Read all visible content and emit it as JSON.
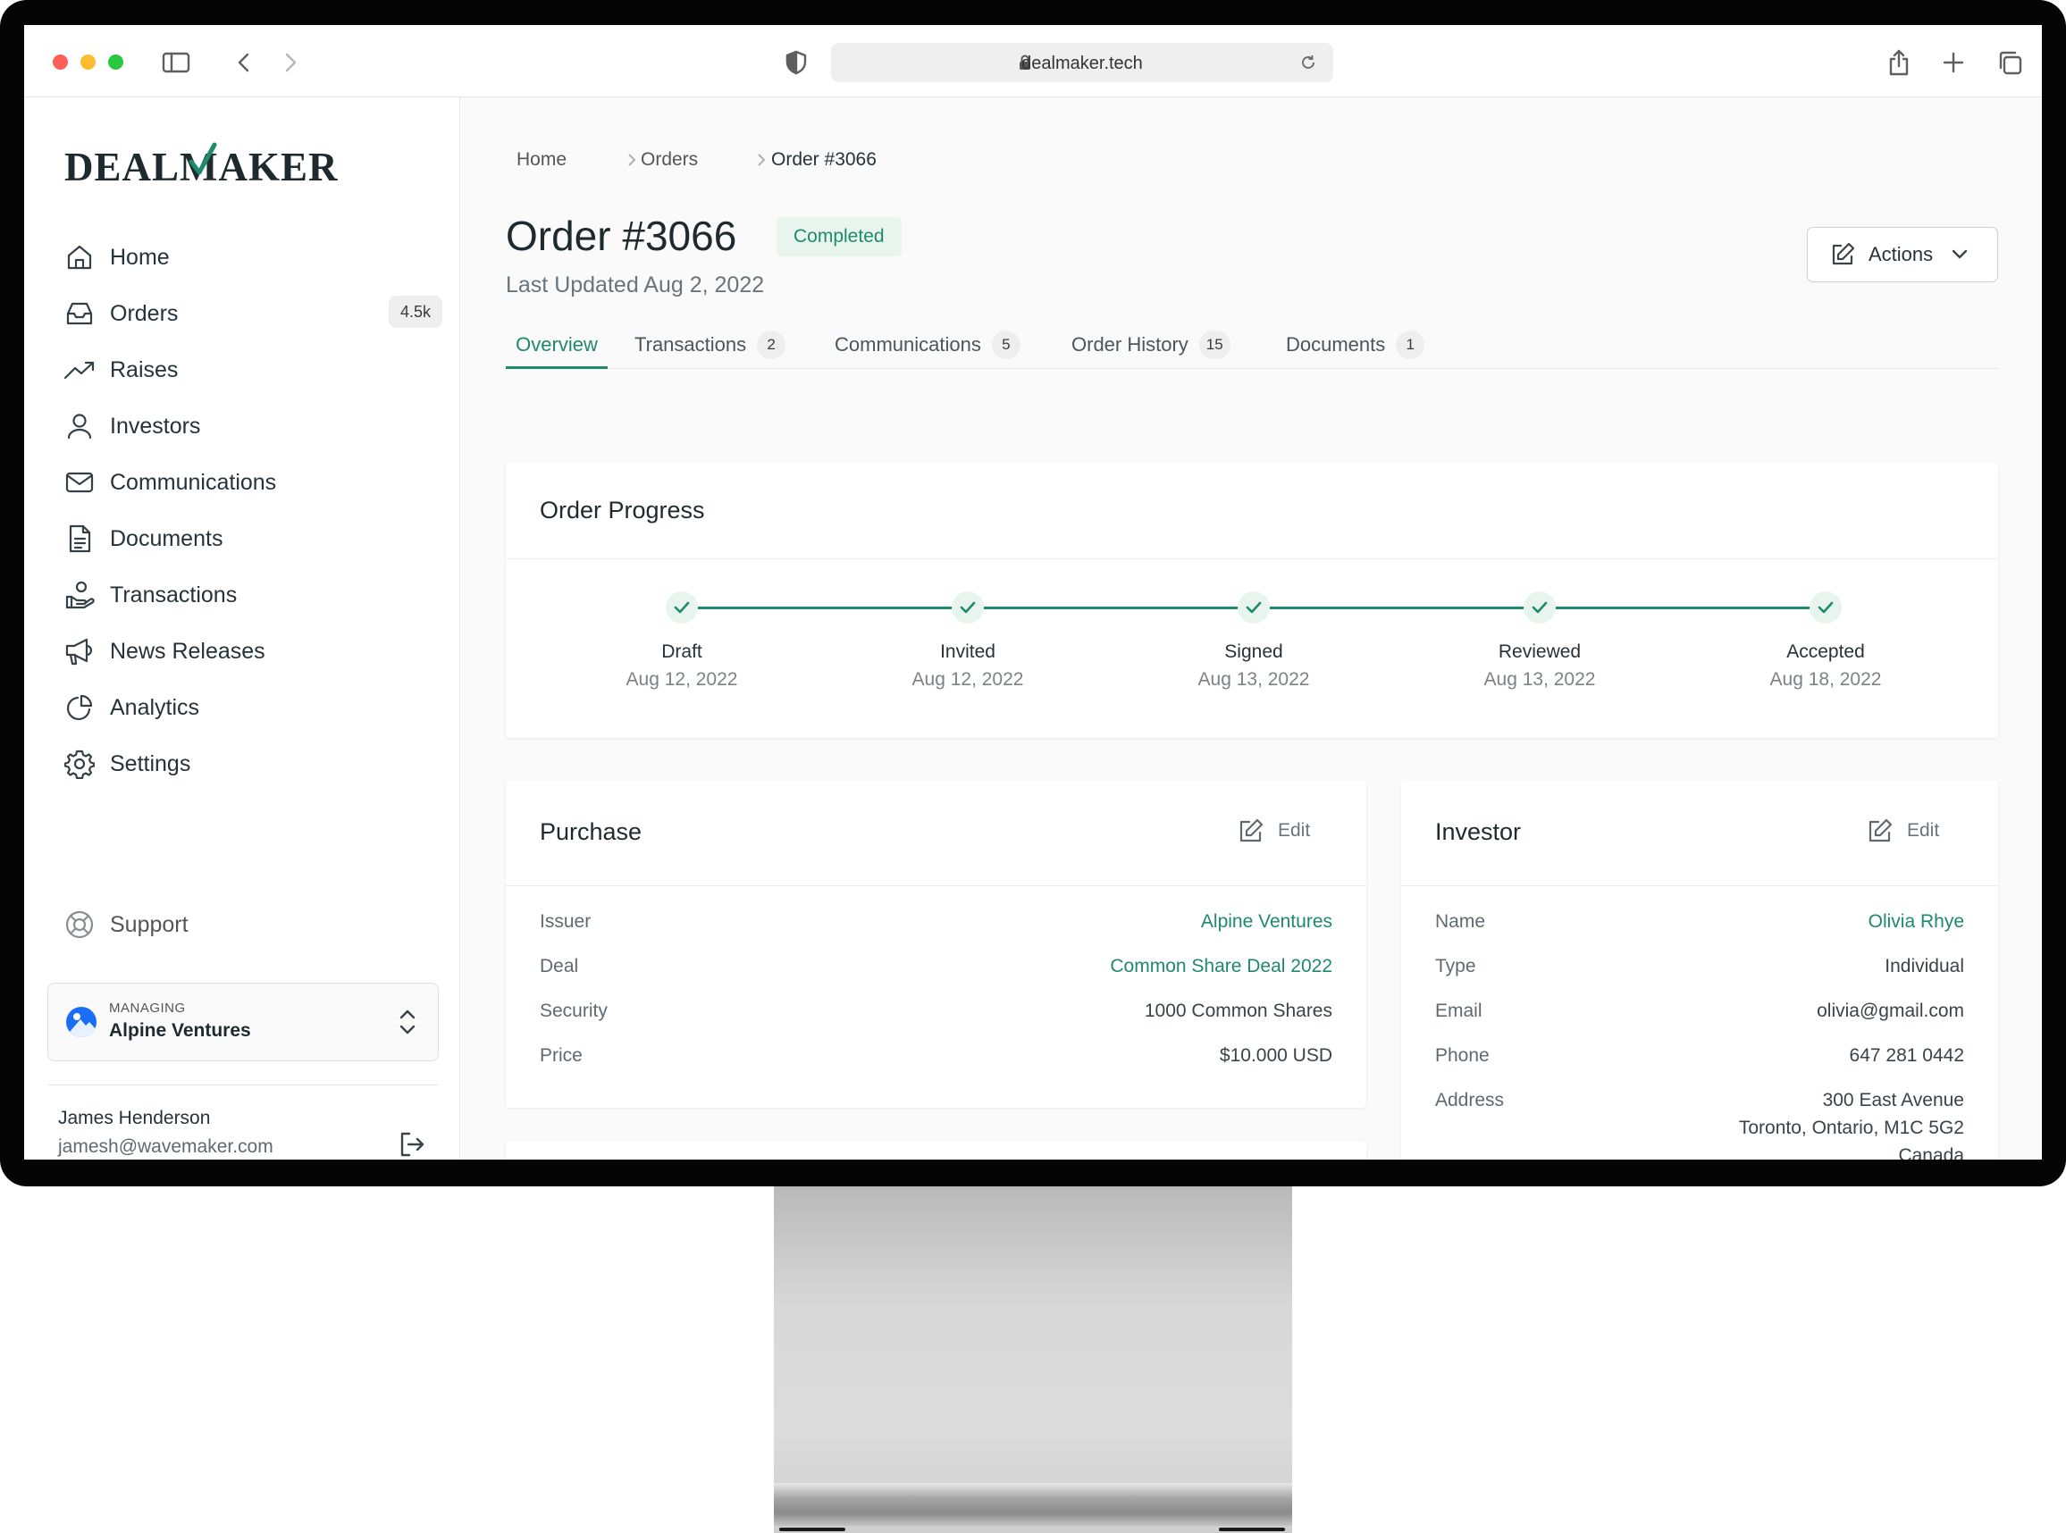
{
  "browser": {
    "url": "dealmaker.tech",
    "traffic_lights": [
      "#ff5f57",
      "#febc2e",
      "#28c840"
    ]
  },
  "brand": {
    "logo": "DEALMAKER",
    "accent_color": "#1e8a6b"
  },
  "sidebar": {
    "items": [
      {
        "label": "Home",
        "icon": "home-icon"
      },
      {
        "label": "Orders",
        "icon": "inbox-icon",
        "badge": "4.5k"
      },
      {
        "label": "Raises",
        "icon": "trend-icon"
      },
      {
        "label": "Investors",
        "icon": "user-icon"
      },
      {
        "label": "Communications",
        "icon": "mail-icon"
      },
      {
        "label": "Documents",
        "icon": "document-icon"
      },
      {
        "label": "Transactions",
        "icon": "transactions-icon"
      },
      {
        "label": "News Releases",
        "icon": "megaphone-icon"
      },
      {
        "label": "Analytics",
        "icon": "pie-chart-icon"
      },
      {
        "label": "Settings",
        "icon": "gear-icon"
      }
    ],
    "support_label": "Support",
    "managing": {
      "small_label": "MANAGING",
      "name": "Alpine Ventures"
    },
    "user": {
      "name": "James Henderson",
      "email": "jamesh@wavemaker.com"
    }
  },
  "breadcrumb": [
    "Home",
    "Orders",
    "Order #3066"
  ],
  "order": {
    "title": "Order #3066",
    "status": "Completed",
    "last_updated": "Last Updated Aug 2, 2022",
    "actions_label": "Actions"
  },
  "tabs": [
    {
      "label": "Overview",
      "count": null
    },
    {
      "label": "Transactions",
      "count": "2"
    },
    {
      "label": "Communications",
      "count": "5"
    },
    {
      "label": "Order History",
      "count": "15"
    },
    {
      "label": "Documents",
      "count": "1"
    }
  ],
  "progress": {
    "title": "Order Progress",
    "steps": [
      {
        "name": "Draft",
        "date": "Aug 12, 2022"
      },
      {
        "name": "Invited",
        "date": "Aug 12, 2022"
      },
      {
        "name": "Signed",
        "date": "Aug 13, 2022"
      },
      {
        "name": "Reviewed",
        "date": "Aug 13, 2022"
      },
      {
        "name": "Accepted",
        "date": "Aug 18, 2022"
      }
    ]
  },
  "purchase": {
    "title": "Purchase",
    "edit_label": "Edit",
    "rows": [
      {
        "label": "Issuer",
        "value": "Alpine Ventures",
        "link": true
      },
      {
        "label": "Deal",
        "value": "Common Share Deal 2022",
        "link": true
      },
      {
        "label": "Security",
        "value": "1000 Common Shares",
        "link": false
      },
      {
        "label": "Price",
        "value": "$10.000 USD",
        "link": false
      }
    ]
  },
  "investor": {
    "title": "Investor",
    "edit_label": "Edit",
    "rows": [
      {
        "label": "Name",
        "value": "Olivia Rhye",
        "link": true
      },
      {
        "label": "Type",
        "value": "Individual",
        "link": false
      },
      {
        "label": "Email",
        "value": "olivia@gmail.com",
        "link": false
      },
      {
        "label": "Phone",
        "value": "647 281 0442",
        "link": false
      }
    ],
    "address_label": "Address",
    "address_lines": [
      "300 East Avenue",
      "Toronto, Ontario, M1C 5G2",
      "Canada"
    ]
  }
}
